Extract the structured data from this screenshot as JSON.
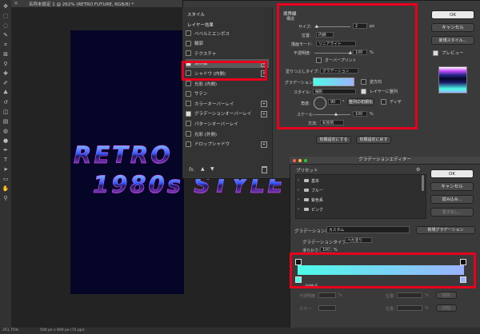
{
  "document": {
    "tab_title": "名称未設定 1 @ 262% (RETRO FUTURE, RGB/8) *",
    "close_glyph": "×",
    "canvas_text_line1": "RETRO",
    "canvas_text_line2": "1980s STYLE",
    "zoom": "261.75%",
    "doc_size": "500 px x 600 px (72 ppi)"
  },
  "toolbar": {
    "icons": [
      "move-icon",
      "marquee-icon",
      "lasso-icon",
      "quick-select-icon",
      "crop-icon",
      "frame-icon",
      "eyedropper-icon",
      "healing-icon",
      "brush-icon",
      "stamp-icon",
      "history-brush-icon",
      "eraser-icon",
      "gradient-icon",
      "blur-icon",
      "dodge-icon",
      "pen-icon",
      "type-icon",
      "path-select-icon",
      "shape-icon",
      "hand-icon",
      "zoom-icon"
    ]
  },
  "layer_style": {
    "left_header": "スタイル",
    "blend_options": "レイヤー効果",
    "items": [
      {
        "label": "ベベルとエンボス",
        "checked": false,
        "plus": false
      },
      {
        "label": "輪郭",
        "checked": false,
        "plus": false
      },
      {
        "label": "テクスチャ",
        "checked": false,
        "plus": false
      },
      {
        "label": "境界線",
        "checked": true,
        "plus": true
      },
      {
        "label": "シャドウ (内側)",
        "checked": false,
        "plus": true
      },
      {
        "label": "光彩 (内側)",
        "checked": false,
        "plus": false
      },
      {
        "label": "サテン",
        "checked": false,
        "plus": false
      },
      {
        "label": "カラーオーバーレイ",
        "checked": false,
        "plus": true
      },
      {
        "label": "グラデーションオーバーレイ",
        "checked": true,
        "plus": true
      },
      {
        "label": "パターンオーバーレイ",
        "checked": false,
        "plus": false
      },
      {
        "label": "光彩 (外側)",
        "checked": false,
        "plus": false
      },
      {
        "label": "ドロップシャドウ",
        "checked": false,
        "plus": true
      }
    ],
    "footer_icons": [
      "fx-icon",
      "arrow-up-icon",
      "arrow-down-icon",
      "trash-icon"
    ],
    "footer_fx": "fx.",
    "stroke": {
      "title": "境界線",
      "section": "構造",
      "size_label": "サイズ:",
      "size_value": "2",
      "size_unit": "px",
      "position_label": "位置:",
      "position_value": "内側",
      "blend_label": "描画モード:",
      "blend_value": "リニアライト",
      "opacity_label": "不透明度:",
      "opacity_value": "100",
      "opacity_unit": "%",
      "overprint_label": "オーバープリント",
      "fill_type_label": "塗りつぶしタイプ:",
      "fill_type_value": "グラデーション",
      "gradient_label": "グラデーション:",
      "reverse_label": "逆方向",
      "style_label": "スタイル:",
      "style_value": "線形",
      "align_label": "レイヤーに整列",
      "angle_label": "角度:",
      "angle_value": "90",
      "angle_unit": "°",
      "reset_align_label": "整列の初期化",
      "dither_label": "ディザ",
      "scale_label": "スケール:",
      "scale_value": "100",
      "scale_unit": "%",
      "method_label": "方法:",
      "method_value": "知覚的",
      "make_default": "初期設定にする",
      "reset_default": "初期設定に戻す"
    },
    "buttons": {
      "ok": "OK",
      "cancel": "キャンセル",
      "new_style": "新規スタイル...",
      "preview": "プレビュー"
    }
  },
  "gradient_editor": {
    "title": "グラデーションエディター",
    "presets_label": "プリセット",
    "folders": [
      "基本",
      "ブルー",
      "紫色系",
      "ピンク"
    ],
    "name_label": "グラデーション名:",
    "name_value": "カスタム",
    "new_gradient": "新規グラデーション",
    "type_label": "グラデーションタイプ:",
    "type_value": "べた塗り",
    "smooth_label": "滑らかさ:",
    "smooth_value": "100",
    "smooth_unit": "%",
    "ok": "OK",
    "cancel": "キャンセル",
    "load": "読み込み...",
    "save": "書き出し...",
    "stops_label": "分岐点",
    "opacity_label": "不透明度:",
    "opacity_unit": "%",
    "location_label": "位置:",
    "location_unit": "%",
    "delete_label": "削除",
    "color_label": "カラー:",
    "gradient_start": "#4dfbe8",
    "gradient_end": "#9db3ff"
  },
  "colors": {
    "highlight_red": "#e8001c",
    "canvas_bg": "#050528",
    "selected_row": "#5a5a5a"
  }
}
